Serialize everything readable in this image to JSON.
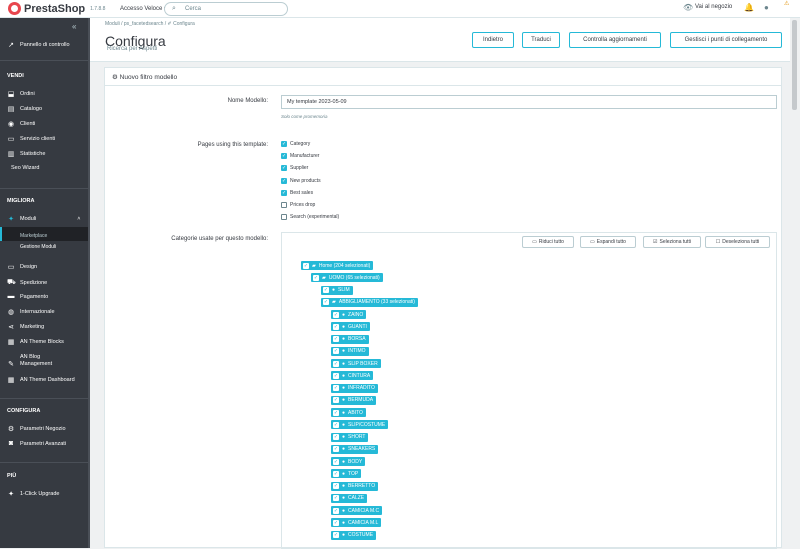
{
  "topbar": {
    "logo": "PrestaShop",
    "version": "1.7.8.8",
    "quick_access": "Accesso Veloce ▾",
    "search_placeholder": "Cerca",
    "shop_link": "Vai al negozio",
    "warning": "⚠"
  },
  "sidebar": {
    "dashboard": "Pannello di controllo",
    "section_sell": "VENDI",
    "sell_items": [
      "Ordini",
      "Catalogo",
      "Clienti",
      "Servizio clienti",
      "Statistiche",
      "Seo Wizard"
    ],
    "section_improve": "MIGLIORA",
    "moduli": "Moduli",
    "moduli_subs": [
      "Marketplace",
      "Gestione Moduli"
    ],
    "improve_items": [
      "Design",
      "Spedizione",
      "Pagamento",
      "Internazionale",
      "Marketing",
      "AN Theme Blocks",
      "AN Blog Management",
      "AN Theme Dashboard"
    ],
    "section_config": "CONFIGURA",
    "config_items": [
      "Parametri Negozio",
      "Parametri Avanzati"
    ],
    "section_more": "PIÙ",
    "more_items": [
      "1-Click Upgrade"
    ]
  },
  "header": {
    "breadcrumb": "Moduli  /  ps_facetedsearch  /  ✐ Configura",
    "title": "Configura",
    "subtitle": "Ricerca per Aspetti",
    "buttons": [
      "Indietro",
      "Traduci",
      "Controlla aggiornamenti",
      "Gestisci i punti di collegamento"
    ]
  },
  "panel": {
    "title": "Nuovo filtro modello",
    "name_label": "Nome Modello:",
    "name_value": "My template 2023-05-09",
    "name_help": "Solo come promemoria",
    "pages_label": "Pages using this template:",
    "pages": [
      {
        "label": "Category",
        "checked": true
      },
      {
        "label": "Manufacturer",
        "checked": true
      },
      {
        "label": "Supplier",
        "checked": true
      },
      {
        "label": "New products",
        "checked": true
      },
      {
        "label": "Best sales",
        "checked": true
      },
      {
        "label": "Prices drop",
        "checked": false
      },
      {
        "label": "Search (experimental)",
        "checked": false
      }
    ],
    "categories_label": "Categorie usate per questo modello:",
    "tree_buttons": [
      "Riduci tutto",
      "Espandi tutto",
      "Seleziona tutti",
      "Deseleziona tutti"
    ],
    "tree": [
      {
        "label": "Home (204 selezionati)",
        "level": 0,
        "folder": true
      },
      {
        "label": "UOMO (65 selezionati)",
        "level": 1,
        "folder": true
      },
      {
        "label": "SLIM",
        "level": 2,
        "folder": false
      },
      {
        "label": "ABBIGLIAMENTO (33 selezionati)",
        "level": 2,
        "folder": true
      },
      {
        "label": "ZAINO",
        "level": 3,
        "folder": false
      },
      {
        "label": "GUANTI",
        "level": 3,
        "folder": false
      },
      {
        "label": "BORSA",
        "level": 3,
        "folder": false
      },
      {
        "label": "INTIMO",
        "level": 3,
        "folder": false
      },
      {
        "label": "SLIP BOXER",
        "level": 3,
        "folder": false
      },
      {
        "label": "CINTURA",
        "level": 3,
        "folder": false
      },
      {
        "label": "INFRADITO",
        "level": 3,
        "folder": false
      },
      {
        "label": "BERMUDA",
        "level": 3,
        "folder": false
      },
      {
        "label": "ABITO",
        "level": 3,
        "folder": false
      },
      {
        "label": "SLIP/COSTUME",
        "level": 3,
        "folder": false
      },
      {
        "label": "SHORT",
        "level": 3,
        "folder": false
      },
      {
        "label": "SNEAKERS",
        "level": 3,
        "folder": false
      },
      {
        "label": "BODY",
        "level": 3,
        "folder": false
      },
      {
        "label": "TOP",
        "level": 3,
        "folder": false
      },
      {
        "label": "BERRETTO",
        "level": 3,
        "folder": false
      },
      {
        "label": "CALZE",
        "level": 3,
        "folder": false
      },
      {
        "label": "CAMICIA M.C",
        "level": 3,
        "folder": false
      },
      {
        "label": "CAMICIA M.L",
        "level": 3,
        "folder": false
      },
      {
        "label": "COSTUME",
        "level": 3,
        "folder": false
      }
    ]
  },
  "colors": {
    "accent": "#25b9d7",
    "sidebar": "#363a41",
    "logo": "#e8464e"
  }
}
